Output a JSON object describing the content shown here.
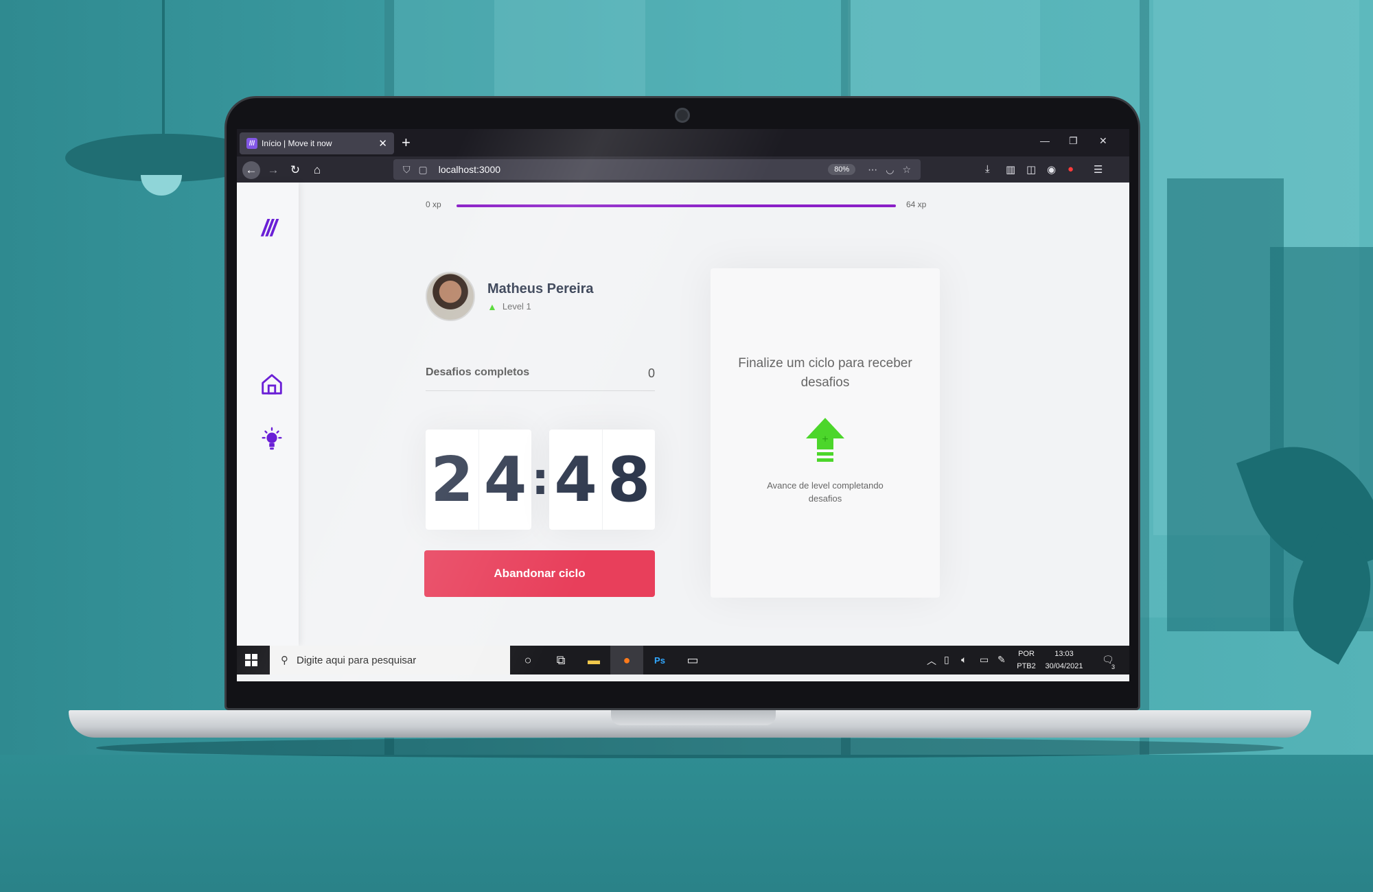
{
  "browser": {
    "tab_title": "Início | Move it now",
    "tab_favicon": "///",
    "new_tab": "+",
    "url": "localhost:3000",
    "zoom": "80%",
    "window_minimize": "—",
    "window_restore": "❐",
    "window_close": "✕"
  },
  "app": {
    "logo": "///",
    "xp_start": "0 xp",
    "xp_end": "64 xp",
    "xp_progress_fraction": 1.0,
    "profile_name": "Matheus Pereira",
    "profile_level": "Level 1",
    "completed_label": "Desafios completos",
    "completed_value": "0",
    "timer": {
      "m1": "2",
      "m2": "4",
      "colon": ":",
      "s1": "4",
      "s2": "8"
    },
    "abandon_button": "Abandonar ciclo",
    "card_title": "Finalize um ciclo para receber desafios",
    "card_text": "Avance de level completando desafios",
    "accent_color": "#8b1fc7",
    "button_color": "#e83f5b",
    "level_color": "#4cd62b"
  },
  "taskbar": {
    "search_placeholder": "Digite aqui para pesquisar",
    "lang_top": "POR",
    "lang_bottom": "PTB2",
    "time": "13:03",
    "date": "30/04/2021",
    "notification_count": "3"
  }
}
